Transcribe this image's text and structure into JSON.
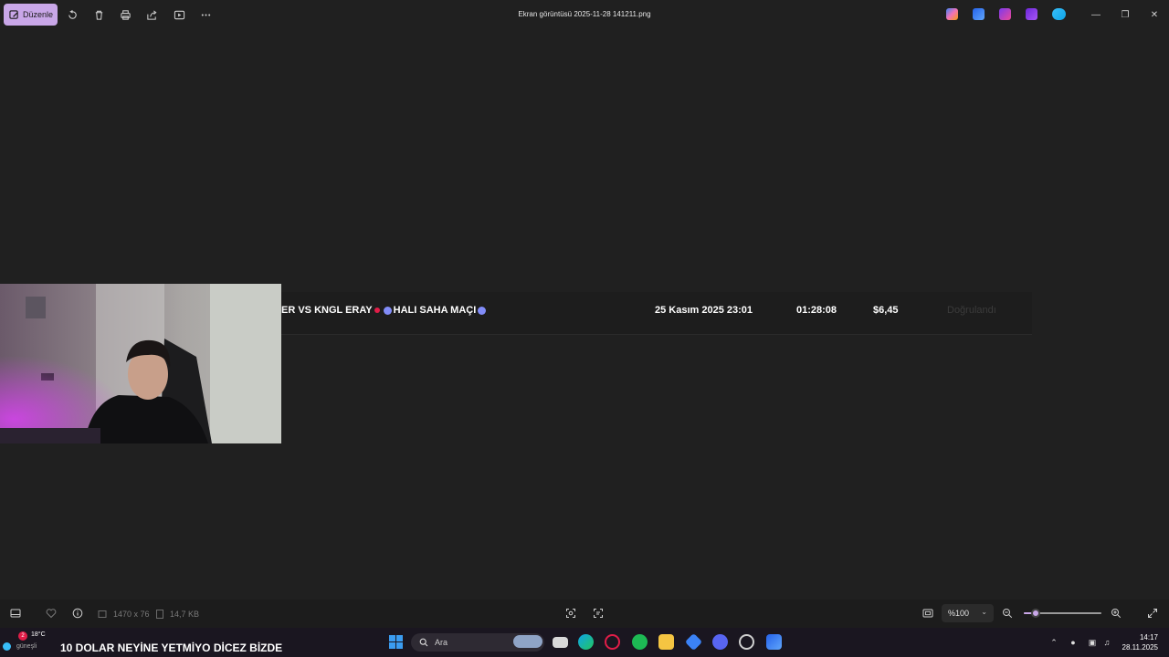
{
  "toolbar": {
    "edit_label": "Düzenle",
    "title": "Ekran görüntüsü 2025-11-28 141211.png"
  },
  "image_row": {
    "title_text": "ER VS KNGL ERAY",
    "subtitle_text": "HALI SAHA MAÇI",
    "date": "25 Kasım 2025 23:01",
    "duration": "01:28:08",
    "amount": "$6,45",
    "status": "Doğrulandı"
  },
  "statusbar": {
    "dimensions": "1470 x 76",
    "file_size": "14,7 KB",
    "zoom": "%100",
    "zoom_fraction": 0.15
  },
  "taskbar": {
    "temperature": "18°C",
    "weather_sub": "güneşli",
    "notification_count": "2",
    "marquee": "10 DOLAR NEYİNE YETMİYO DİCEZ BİZDE",
    "search_placeholder": "Ara",
    "time": "14:17",
    "date": "28.11.2025"
  },
  "colors": {
    "accent": "#c9a7e8",
    "background": "#202020",
    "taskbar": "#1a1620"
  }
}
